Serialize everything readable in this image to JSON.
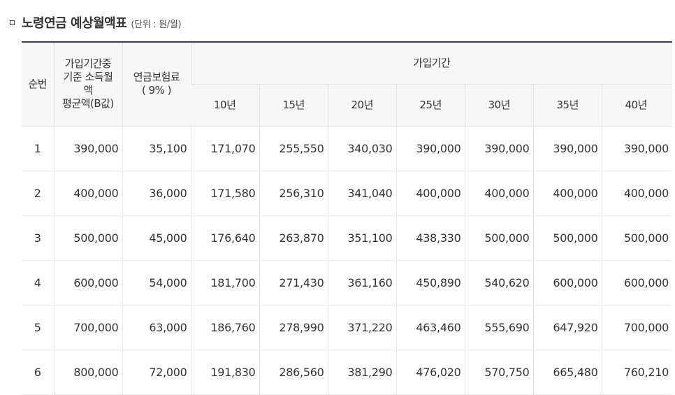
{
  "title": {
    "main": "노령연금 예상월액표",
    "unit": "(단위 : 원/월)"
  },
  "table": {
    "headers": {
      "index": "순번",
      "income_line1": "가입기간중",
      "income_line2": "기준 소득월",
      "income_line3": "액",
      "income_line4": "평균액(B값)",
      "premium_line1": "연금보험료",
      "premium_line2": "( 9% )",
      "period_group": "가입기간",
      "periods": [
        "10년",
        "15년",
        "20년",
        "25년",
        "30년",
        "35년",
        "40년"
      ]
    },
    "rows": [
      {
        "index": "1",
        "income": "390,000",
        "premium": "35,100",
        "values": [
          "171,070",
          "255,550",
          "340,030",
          "390,000",
          "390,000",
          "390,000",
          "390,000"
        ]
      },
      {
        "index": "2",
        "income": "400,000",
        "premium": "36,000",
        "values": [
          "171,580",
          "256,310",
          "341,040",
          "400,000",
          "400,000",
          "400,000",
          "400,000"
        ]
      },
      {
        "index": "3",
        "income": "500,000",
        "premium": "45,000",
        "values": [
          "176,640",
          "263,870",
          "351,100",
          "438,330",
          "500,000",
          "500,000",
          "500,000"
        ]
      },
      {
        "index": "4",
        "income": "600,000",
        "premium": "54,000",
        "values": [
          "181,700",
          "271,430",
          "361,160",
          "450,890",
          "540,620",
          "600,000",
          "600,000"
        ]
      },
      {
        "index": "5",
        "income": "700,000",
        "premium": "63,000",
        "values": [
          "186,760",
          "278,990",
          "371,220",
          "463,460",
          "555,690",
          "647,920",
          "700,000"
        ]
      },
      {
        "index": "6",
        "income": "800,000",
        "premium": "72,000",
        "values": [
          "191,830",
          "286,560",
          "381,290",
          "476,020",
          "570,750",
          "665,480",
          "760,210"
        ]
      }
    ]
  }
}
